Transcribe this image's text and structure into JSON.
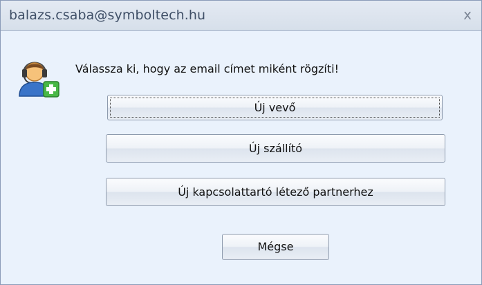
{
  "window": {
    "title": "balazs.csaba@symboltech.hu",
    "close_glyph": "x"
  },
  "prompt": "Válassza ki, hogy az email címet miként rögzíti!",
  "icon": "add-contact-icon",
  "buttons": {
    "new_customer": "Új vevő",
    "new_supplier": "Új szállító",
    "new_contact": "Új kapcsolattartó létező partnerhez",
    "cancel": "Mégse"
  }
}
